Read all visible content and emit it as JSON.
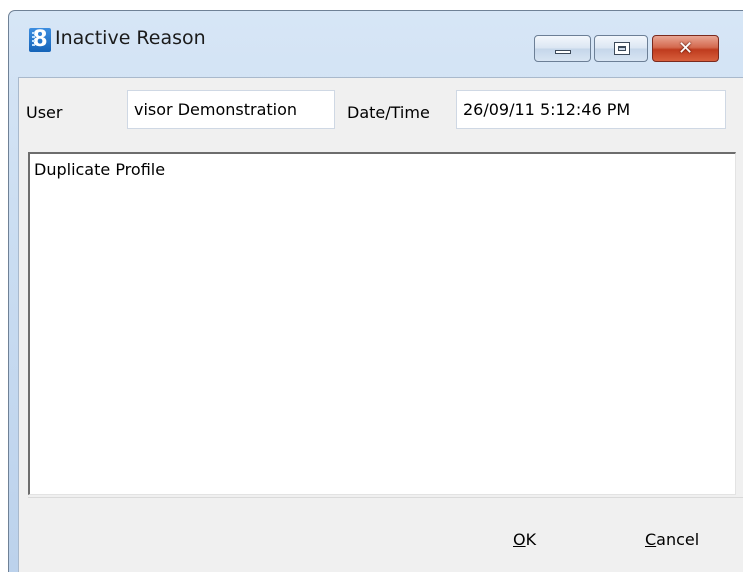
{
  "window": {
    "title": "Inactive Reason",
    "icon": "app-8-icon",
    "controls": {
      "minimize": "minimize",
      "maximize": "maximize",
      "close": "✕"
    }
  },
  "form": {
    "user_label": "User",
    "user_value": "visor Demonstration",
    "datetime_label": "Date/Time",
    "datetime_value": "26/09/11 5:12:46 PM",
    "reason_text": "Duplicate Profile"
  },
  "buttons": {
    "ok": {
      "accel": "O",
      "rest": "K"
    },
    "cancel": {
      "accel": "C",
      "rest": "ancel"
    }
  },
  "colors": {
    "titlebar": "#c9dcf1",
    "close_button": "#c8452a",
    "client_bg": "#f0f0f0"
  }
}
